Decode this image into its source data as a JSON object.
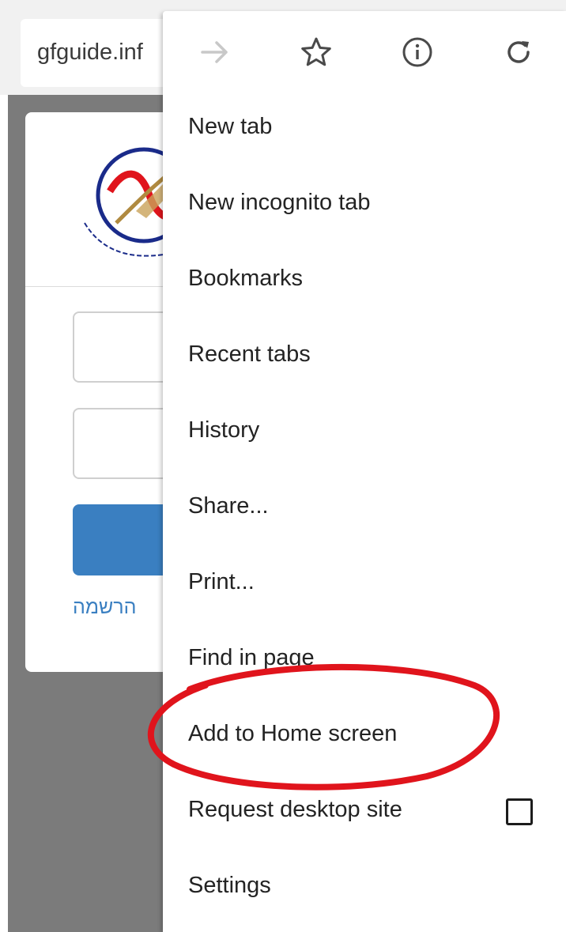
{
  "browser": {
    "url": "gfguide.inf"
  },
  "page": {
    "register_link": "הרשמה"
  },
  "toolbar": {
    "icons": [
      "forward-arrow-icon",
      "star-icon",
      "info-icon",
      "reload-icon"
    ]
  },
  "menu": {
    "items": [
      {
        "label": "New tab"
      },
      {
        "label": "New incognito tab"
      },
      {
        "label": "Bookmarks"
      },
      {
        "label": "Recent tabs"
      },
      {
        "label": "History"
      },
      {
        "label": "Share..."
      },
      {
        "label": "Print..."
      },
      {
        "label": "Find in page"
      },
      {
        "label": "Add to Home screen"
      },
      {
        "label": "Request desktop site",
        "checkbox_checked": false
      },
      {
        "label": "Settings"
      }
    ]
  },
  "colors": {
    "accent_blue": "#3a7fc1",
    "annotation_red": "#e0141c",
    "page_overlay": "#7b7b7b"
  }
}
